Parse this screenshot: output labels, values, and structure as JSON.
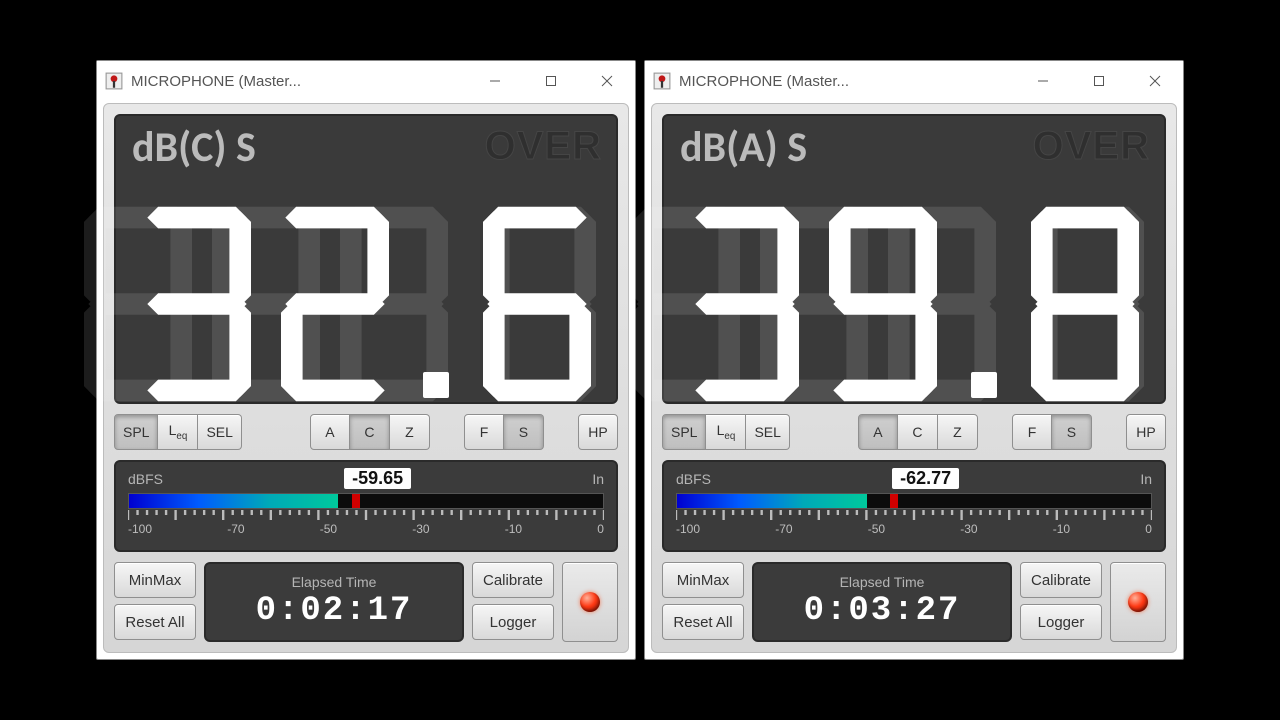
{
  "windows": [
    {
      "title": "MICROPHONE (Master...",
      "mode_label": "dB(C) S",
      "over_label": "OVER",
      "value_digits": [
        "3",
        "2",
        ".",
        "6"
      ],
      "dbfs_label": "dBFS",
      "dbfs_value": "-59.65",
      "in_label": "In",
      "meter_fill_pct": 44,
      "meter_peak_pct": 47,
      "scale_labels": [
        "-100",
        "-70",
        "-50",
        "-30",
        "-10",
        "0"
      ],
      "buttons": {
        "spl": "SPL",
        "leq_pre": "L",
        "leq_sub": "eq",
        "sel": "SEL",
        "a": "A",
        "c": "C",
        "z": "Z",
        "f": "F",
        "s": "S",
        "hp": "HP"
      },
      "active": {
        "spl": true,
        "c": true,
        "s": true
      },
      "bottom": {
        "minmax": "MinMax",
        "resetall": "Reset All",
        "elapsed_label": "Elapsed Time",
        "elapsed_value": "0:02:17",
        "calibrate": "Calibrate",
        "logger": "Logger"
      }
    },
    {
      "title": "MICROPHONE (Master...",
      "mode_label": "dB(A) S",
      "over_label": "OVER",
      "value_digits": [
        "3",
        "9",
        ".",
        "8"
      ],
      "dbfs_label": "dBFS",
      "dbfs_value": "-62.77",
      "in_label": "In",
      "meter_fill_pct": 40,
      "meter_peak_pct": 45,
      "scale_labels": [
        "-100",
        "-70",
        "-50",
        "-30",
        "-10",
        "0"
      ],
      "buttons": {
        "spl": "SPL",
        "leq_pre": "L",
        "leq_sub": "eq",
        "sel": "SEL",
        "a": "A",
        "c": "C",
        "z": "Z",
        "f": "F",
        "s": "S",
        "hp": "HP"
      },
      "active": {
        "spl": true,
        "a": true,
        "s": true
      },
      "bottom": {
        "minmax": "MinMax",
        "resetall": "Reset All",
        "elapsed_label": "Elapsed Time",
        "elapsed_value": "0:03:27",
        "calibrate": "Calibrate",
        "logger": "Logger"
      }
    }
  ]
}
